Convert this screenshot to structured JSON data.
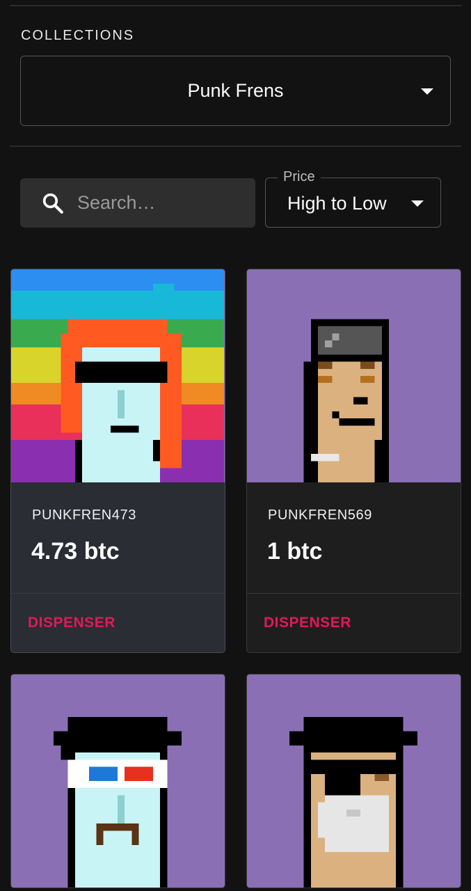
{
  "collections": {
    "label": "COLLECTIONS",
    "selected": "Punk Frens"
  },
  "search": {
    "placeholder": "Search…"
  },
  "sort": {
    "label": "Price",
    "selected": "High to Low"
  },
  "cards": [
    {
      "name": "PUNKFREN473",
      "price": "4.73 btc",
      "action": "DISPENSER",
      "icon": "punk-fren-473-art"
    },
    {
      "name": "PUNKFREN569",
      "price": "1 btc",
      "action": "DISPENSER",
      "icon": "punk-fren-569-art"
    },
    {
      "icon": "punk-3d-glasses-art"
    },
    {
      "icon": "punk-eyepatch-art"
    }
  ],
  "colors": {
    "accent": "#e0195a",
    "background": "#121212",
    "card_bg": "#1e1e1e",
    "art_bg": "#8b6fb5"
  }
}
